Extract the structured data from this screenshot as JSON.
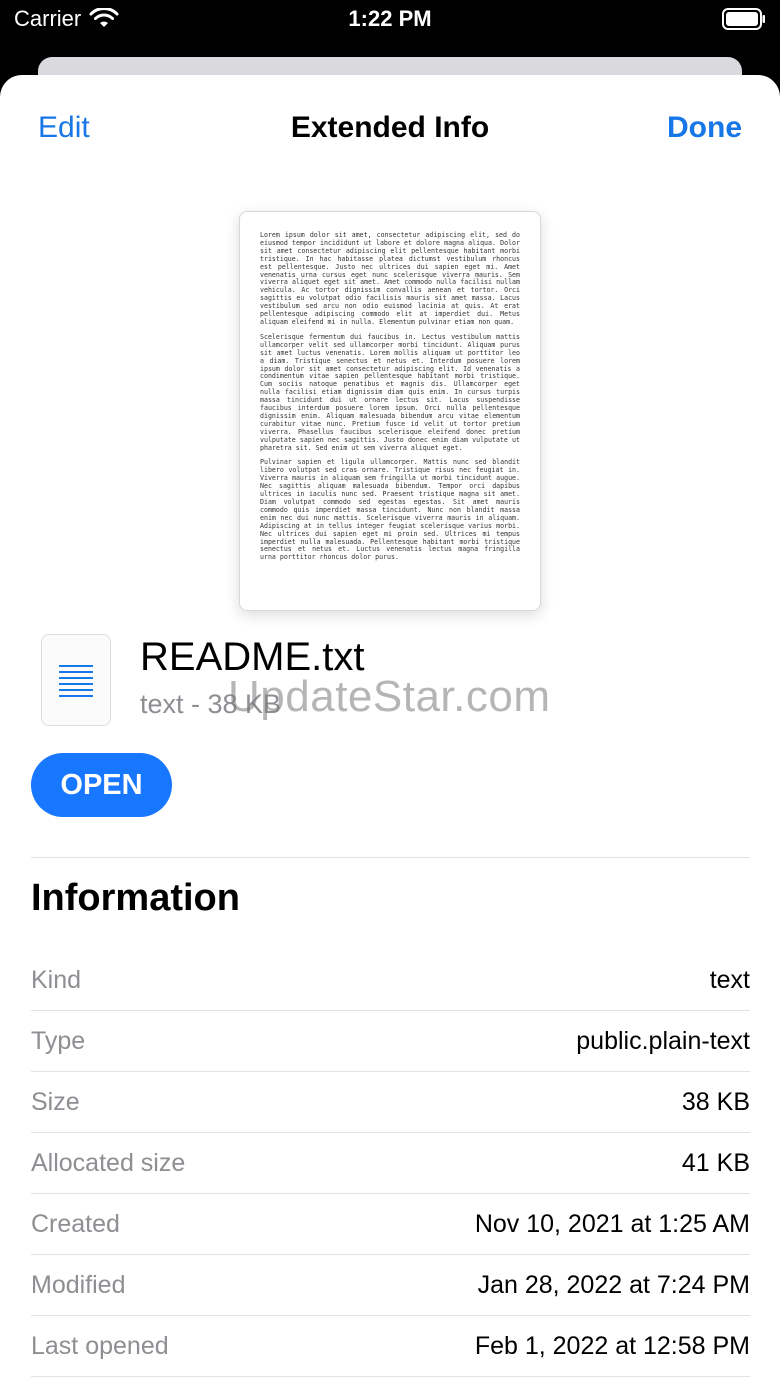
{
  "status_bar": {
    "carrier": "Carrier",
    "time": "1:22 PM"
  },
  "nav": {
    "edit_label": "Edit",
    "title": "Extended Info",
    "done_label": "Done"
  },
  "preview": {
    "paragraphs": [
      "Lorem ipsum dolor sit amet, consectetur adipiscing elit, sed do eiusmod tempor incididunt ut labore et dolore magna aliqua. Dolor sit amet consectetur adipiscing elit pellentesque habitant morbi tristique. In hac habitasse platea dictumst vestibulum rhoncus est pellentesque. Justo nec ultrices dui sapien eget mi. Amet venenatis urna cursus eget nunc scelerisque viverra mauris. Sem viverra aliquet eget sit amet. Amet commodo nulla facilisi nullam vehicula. Ac tortor dignissim convallis aenean et tortor. Orci sagittis eu volutpat odio facilisis mauris sit amet massa. Lacus vestibulum sed arcu non odio euismod lacinia at quis. At erat pellentesque adipiscing commodo elit at imperdiet dui. Metus aliquam eleifend mi in nulla. Elementum pulvinar etiam non quam.",
      "Scelerisque fermentum dui faucibus in. Lectus vestibulum mattis ullamcorper velit sed ullamcorper morbi tincidunt. Aliquam purus sit amet luctus venenatis. Lorem mollis aliquam ut porttitor leo a diam. Tristique senectus et netus et. Interdum posuere lorem ipsum dolor sit amet consectetur adipiscing elit. Id venenatis a condimentum vitae sapien pellentesque habitant morbi tristique. Cum sociis natoque penatibus et magnis dis. Ullamcorper eget nulla facilisi etiam dignissim diam quis enim. In cursus turpis massa tincidunt dui ut ornare lectus sit. Lacus suspendisse faucibus interdum posuere lorem ipsum. Orci nulla pellentesque dignissim enim. Aliquam malesuada bibendum arcu vitae elementum curabitur vitae nunc. Pretium fusce id velit ut tortor pretium viverra. Phasellus faucibus scelerisque eleifend donec pretium vulputate sapien nec sagittis. Justo donec enim diam vulputate ut pharetra sit. Sed enim ut sem viverra aliquet eget.",
      "Pulvinar sapien et ligula ullamcorper. Mattis nunc sed blandit libero volutpat sed cras ornare. Tristique risus nec feugiat in. Viverra mauris in aliquam sem fringilla ut morbi tincidunt augue. Nec sagittis aliquam malesuada bibendum. Tempor orci dapibus ultrices in iaculis nunc sed. Praesent tristique magna sit amet. Diam volutpat commodo sed egestas egestas. Sit amet mauris commodo quis imperdiet massa tincidunt. Nunc non blandit massa enim nec dui nunc mattis. Scelerisque viverra mauris in aliquam. Adipiscing at in tellus integer feugiat scelerisque varius morbi. Nec ultrices dui sapien eget mi proin sed. Ultrices mi tempus imperdiet nulla malesuada. Pellentesque habitant morbi tristique senectus et netus et. Luctus venenatis lectus magna fringilla urna porttitor rhoncus dolor purus."
    ]
  },
  "file": {
    "name": "README.txt",
    "meta": "text - 38 KB",
    "icon": "text-document-icon"
  },
  "watermark": "UpdateStar.com",
  "open_label": "OPEN",
  "information": {
    "title": "Information",
    "rows": [
      {
        "key": "Kind",
        "value": "text"
      },
      {
        "key": "Type",
        "value": "public.plain-text"
      },
      {
        "key": "Size",
        "value": "38 KB"
      },
      {
        "key": "Allocated size",
        "value": "41 KB"
      },
      {
        "key": "Created",
        "value": "Nov 10, 2021 at 1:25 AM"
      },
      {
        "key": "Modified",
        "value": "Jan 28, 2022 at 7:24 PM"
      },
      {
        "key": "Last opened",
        "value": "Feb 1, 2022 at 12:58 PM"
      }
    ]
  },
  "colors": {
    "accent": "#1877e8",
    "button": "#1877ff",
    "secondary_text": "#8e8e93"
  }
}
